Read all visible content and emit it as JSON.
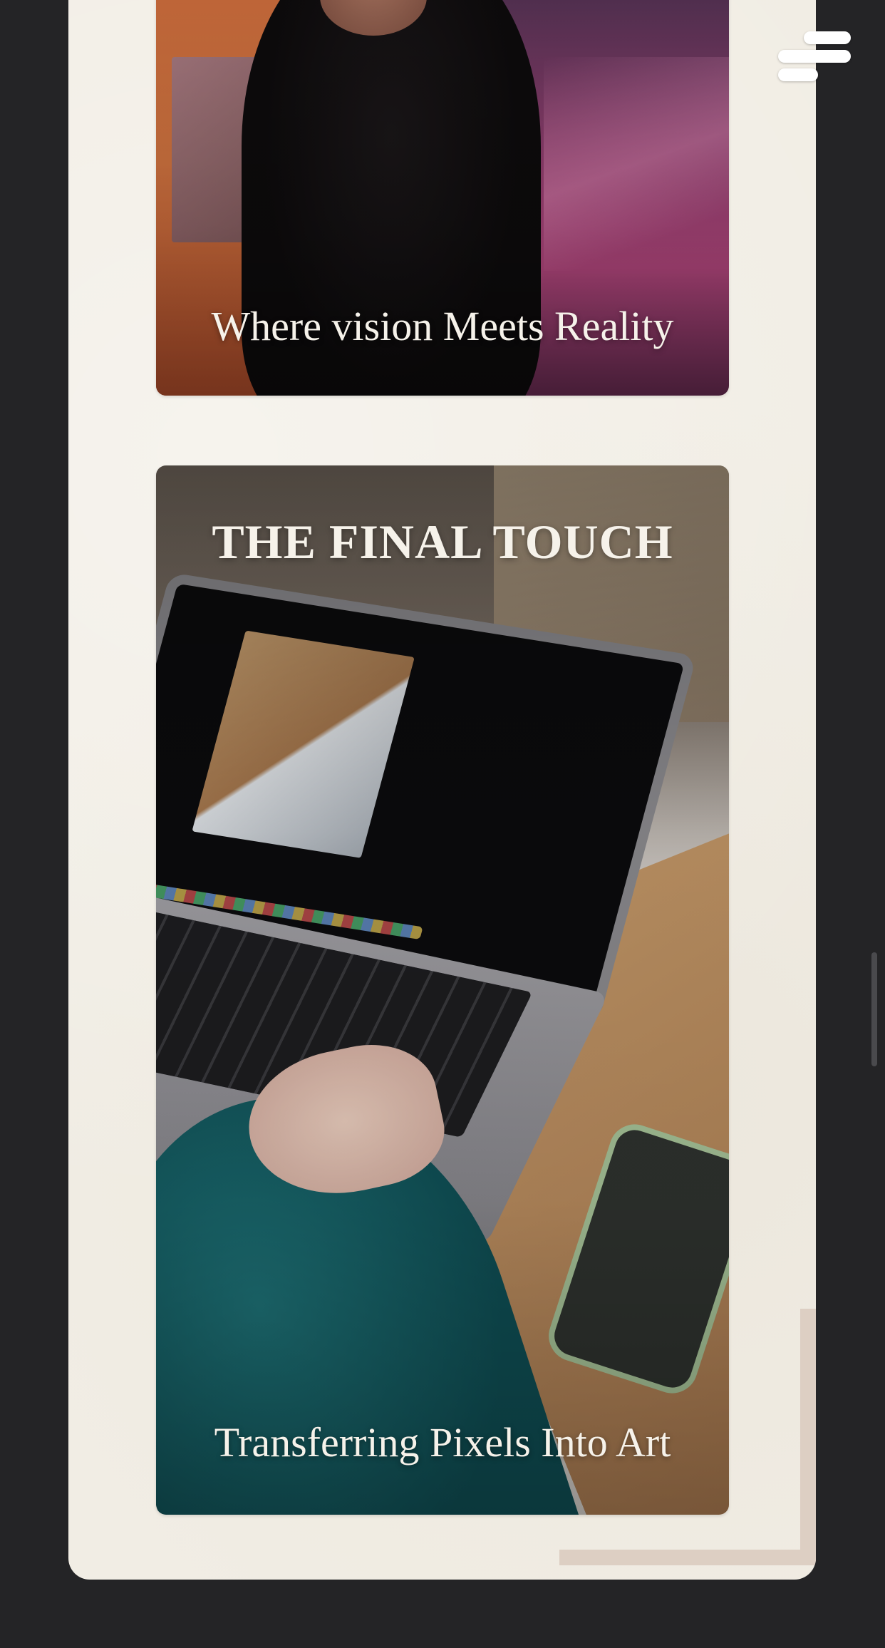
{
  "cards": [
    {
      "title": "",
      "caption": "Where vision Meets Reality",
      "image": "dancer-photo"
    },
    {
      "title": "THE FINAL TOUCH",
      "caption": "Transferring Pixels Into Art",
      "image": "laptop-editing-photo"
    }
  ],
  "menu": {
    "icon": "hamburger-menu-icon"
  },
  "colors": {
    "background": "#242426",
    "panel": "#f1ede4",
    "accent_frame": "#ddcfc3",
    "text_on_image": "#f6f2ea"
  }
}
